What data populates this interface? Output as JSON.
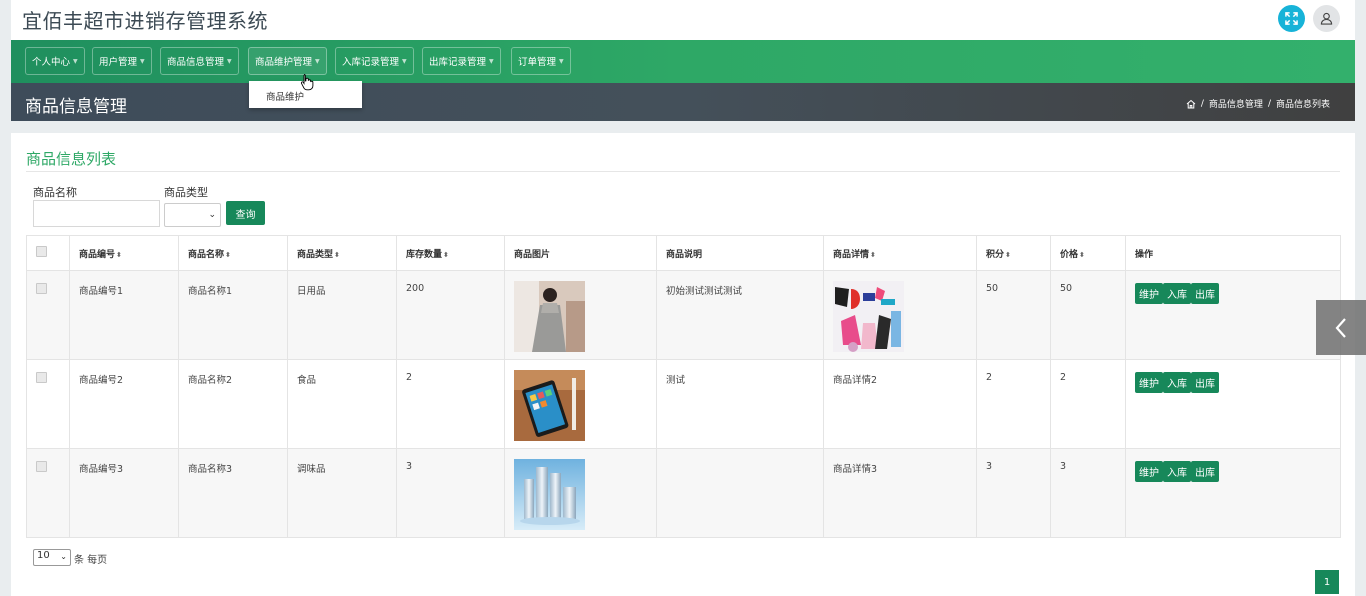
{
  "app_title": "宜佰丰超市进销存管理系统",
  "nav": {
    "items": [
      {
        "label": "个人中心"
      },
      {
        "label": "用户管理"
      },
      {
        "label": "商品信息管理"
      },
      {
        "label": "商品维护管理"
      },
      {
        "label": "入库记录管理"
      },
      {
        "label": "出库记录管理"
      },
      {
        "label": "订单管理"
      }
    ],
    "dropdown_item": "商品维护"
  },
  "page": {
    "title": "商品信息管理",
    "breadcrumb": [
      "商品信息管理",
      "商品信息列表"
    ]
  },
  "card": {
    "title": "商品信息列表"
  },
  "filters": {
    "name_label": "商品名称",
    "name_value": "",
    "type_label": "商品类型",
    "type_value": "",
    "query_button": "查询"
  },
  "table": {
    "columns": [
      "商品编号",
      "商品名称",
      "商品类型",
      "库存数量",
      "商品图片",
      "商品说明",
      "商品详情",
      "积分",
      "价格",
      "操作"
    ],
    "rows": [
      {
        "code": "商品编号1",
        "name": "商品名称1",
        "type": "日用品",
        "stock": "200",
        "image": "dress-photo",
        "desc": "初始测试测试测试",
        "detail": "",
        "detail_image": "shopping-poster",
        "points": "50",
        "price": "50"
      },
      {
        "code": "商品编号2",
        "name": "商品名称2",
        "type": "食品",
        "stock": "2",
        "image": "tablet-photo",
        "desc": "测试",
        "detail": "商品详情2",
        "detail_image": "",
        "points": "2",
        "price": "2"
      },
      {
        "code": "商品编号3",
        "name": "商品名称3",
        "type": "调味品",
        "stock": "3",
        "image": "bottles-photo",
        "desc": "",
        "detail": "商品详情3",
        "detail_image": "",
        "points": "3",
        "price": "3"
      }
    ],
    "actions": [
      "维护",
      "入库",
      "出库"
    ]
  },
  "pager": {
    "page_size": "10",
    "per_page_text": "条 每页",
    "current_page": "1"
  },
  "colors": {
    "nav_green": "#2ea866",
    "button_green": "#17885a",
    "header_dark": "#44505a",
    "fullscreen_blue": "#17b3d8"
  }
}
